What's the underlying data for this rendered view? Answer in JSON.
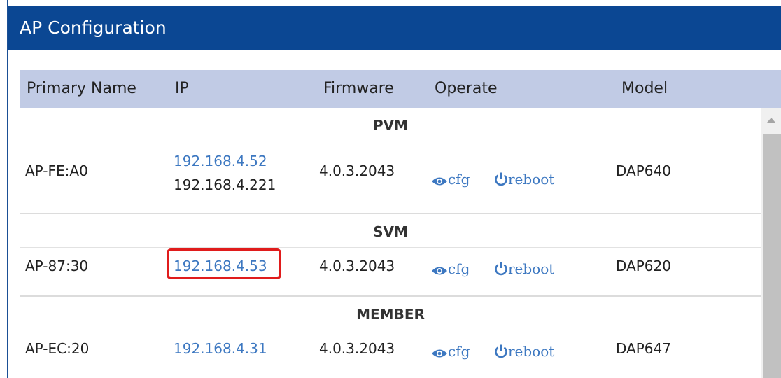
{
  "panel": {
    "title": "AP Configuration"
  },
  "table": {
    "headers": {
      "primary_name": "Primary Name",
      "ip": "IP",
      "firmware": "Firmware",
      "operate": "Operate",
      "model": "Model"
    },
    "groups": [
      {
        "label": "PVM",
        "row": {
          "name": "AP-FE:A0",
          "ip_primary": "192.168.4.52",
          "ip_secondary": "192.168.4.221",
          "firmware": "4.0.3.2043",
          "cfg": "cfg",
          "reboot": "reboot",
          "model": "DAP640"
        }
      },
      {
        "label": "SVM",
        "row": {
          "name": "AP-87:30",
          "ip_primary": "192.168.4.53",
          "firmware": "4.0.3.2043",
          "cfg": "cfg",
          "reboot": "reboot",
          "model": "DAP620"
        }
      },
      {
        "label": "MEMBER",
        "row": {
          "name": "AP-EC:20",
          "ip_primary": "192.168.4.31",
          "firmware": "4.0.3.2043",
          "cfg": "cfg",
          "reboot": "reboot",
          "model": "DAP647"
        }
      }
    ]
  },
  "colors": {
    "title_bar": "#0b4793",
    "header_bg": "#c1cbe5",
    "link": "#3d78c1",
    "highlight": "#e01c1c"
  },
  "icons": {
    "cfg": "eye-icon",
    "reboot": "power-icon"
  }
}
